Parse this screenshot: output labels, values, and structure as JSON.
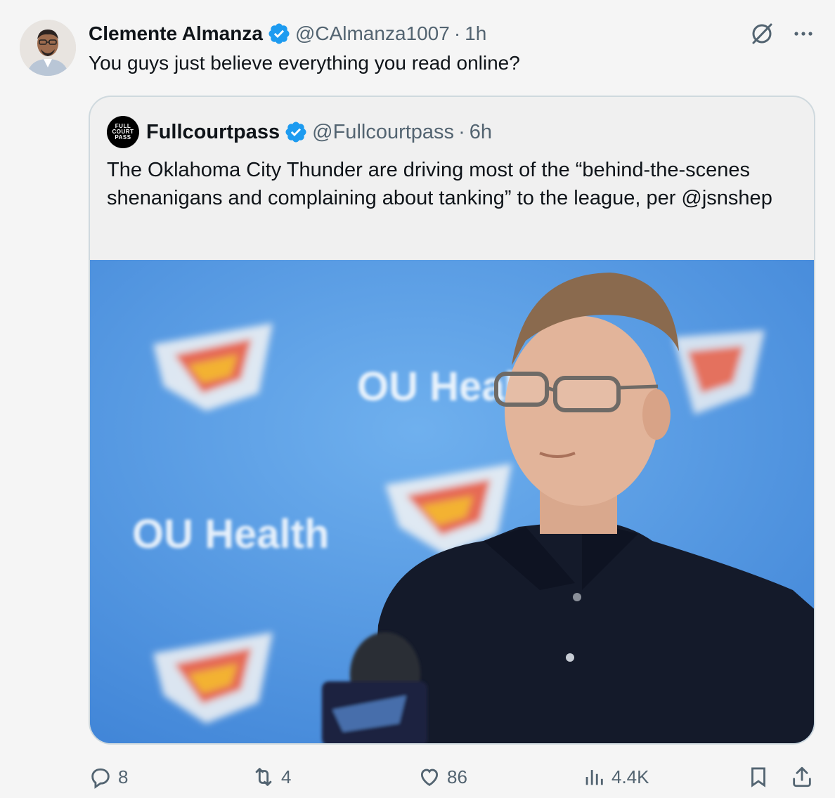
{
  "author": {
    "display_name": "Clemente Almanza",
    "handle": "@CAlmanza1007",
    "separator": "·",
    "time": "1h",
    "text": "You guys just believe everything you read online?"
  },
  "quoted": {
    "avatar_lines": [
      "FULL",
      "COURT",
      "PASS"
    ],
    "display_name": "Fullcourtpass",
    "handle": "@Fullcourtpass",
    "separator": "·",
    "time": "6h",
    "text": "The Oklahoma City Thunder are driving most of the “behind-the-scenes shenanigans and complaining about tanking” to the league, per @jsnshep",
    "media_background_text": [
      "OU Health",
      "OU Health"
    ]
  },
  "metrics": {
    "replies": "8",
    "reposts": "4",
    "likes": "86",
    "views": "4.4K"
  },
  "colors": {
    "verified": "#1d9bf0",
    "muted_text": "#536471",
    "border": "#cfd9de",
    "background": "#f5f5f5"
  },
  "icons": [
    "verified-badge-icon",
    "grok-icon",
    "more-icon",
    "reply-icon",
    "repost-icon",
    "like-icon",
    "views-icon",
    "bookmark-icon",
    "share-icon"
  ]
}
